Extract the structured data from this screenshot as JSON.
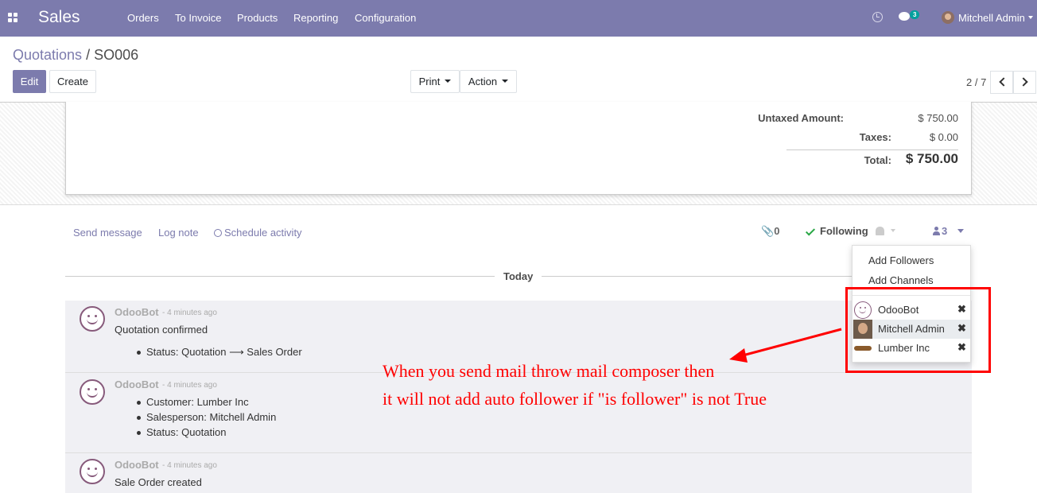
{
  "navbar": {
    "app_name": "Sales",
    "menu": [
      "Orders",
      "To Invoice",
      "Products",
      "Reporting",
      "Configuration"
    ],
    "chat_badge": "3",
    "user": "Mitchell Admin",
    "icons": [
      "apps-grid-icon",
      "clock-icon",
      "chat-icon"
    ]
  },
  "breadcrumb": {
    "parent": "Quotations",
    "separator": "/",
    "current": "SO006"
  },
  "buttons": {
    "edit": "Edit",
    "create": "Create",
    "print": "Print",
    "action": "Action"
  },
  "pager": {
    "value": "2 / 7"
  },
  "totals": {
    "untaxed_label": "Untaxed Amount:",
    "untaxed_value": "$ 750.00",
    "taxes_label": "Taxes:",
    "taxes_value": "$ 0.00",
    "total_label": "Total:",
    "total_value": "$ 750.00"
  },
  "chatter": {
    "send_message": "Send message",
    "log_note": "Log note",
    "schedule_activity": "Schedule activity",
    "attachments": "0",
    "following": "Following",
    "followers_count": "3",
    "today": "Today"
  },
  "followers_dropdown": {
    "add_followers": "Add Followers",
    "add_channels": "Add Channels",
    "followers": [
      {
        "name": "OdooBot",
        "remove": "✖"
      },
      {
        "name": "Mitchell Admin",
        "remove": "✖"
      },
      {
        "name": "Lumber Inc",
        "remove": "✖"
      }
    ]
  },
  "messages": [
    {
      "author": "OdooBot",
      "time": "- 4 minutes ago",
      "text": "Quotation confirmed",
      "bullets": [
        "Status: Quotation ⟶ Sales Order"
      ]
    },
    {
      "author": "OdooBot",
      "time": "- 4 minutes ago",
      "text": "",
      "bullets": [
        "Customer: Lumber Inc",
        "Salesperson: Mitchell Admin",
        "Status: Quotation"
      ]
    },
    {
      "author": "OdooBot",
      "time": "- 4 minutes ago",
      "text": "Sale Order created",
      "bullets": []
    }
  ],
  "annotation": {
    "line1": "When you send mail throw mail composer then",
    "line2": "it will not add auto follower if \"is follower\" is not True",
    "color": "#ff0000"
  },
  "colors": {
    "brand": "#7c7bad",
    "odoobot": "#875a7b"
  }
}
